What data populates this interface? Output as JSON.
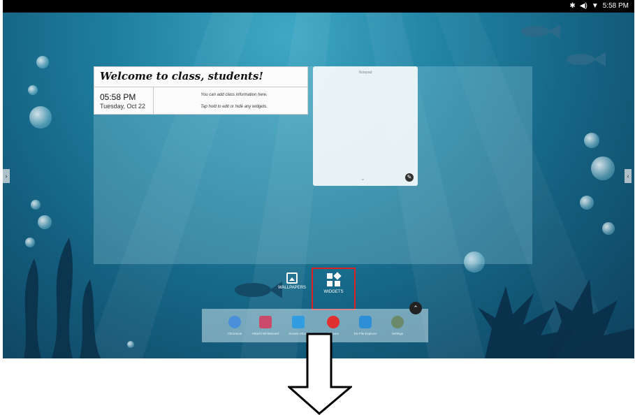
{
  "status_bar": {
    "icons": [
      "bluetooth-icon",
      "volume-icon",
      "wifi-icon"
    ],
    "time": "5:58 PM"
  },
  "welcome_widget": {
    "title": "Welcome to class, students!",
    "time": "05:58 PM",
    "date": "Tuesday, Oct 22",
    "info_line1": "You can add class information here.",
    "info_line2": "Tap hold to edit or hide any widgets."
  },
  "notepad_widget": {
    "title": "Notepad"
  },
  "launcher_buttons": [
    {
      "label": "WALLPAPERS",
      "icon": "wallpaper-icon"
    },
    {
      "label": "WIDGETS",
      "icon": "widgets-icon"
    }
  ],
  "dock": {
    "apps": [
      {
        "label": "Chromium",
        "icon": "chromium-icon",
        "color": "#4a8fd9"
      },
      {
        "label": "Hitachi Whiteboard",
        "icon": "whiteboard-icon",
        "color": "#c94a6a"
      },
      {
        "label": "Screen Share",
        "icon": "cast-icon",
        "color": "#2f9de0"
      },
      {
        "label": "Camera",
        "icon": "record-icon",
        "color": "#e03030"
      },
      {
        "label": "ES File Explorer",
        "icon": "es-file-icon",
        "color": "#2d8fd8"
      },
      {
        "label": "Settings",
        "icon": "gear-icon",
        "color": "#6a8a6a"
      }
    ]
  },
  "colors": {
    "highlight": "#e02020",
    "status_bar": "#000000"
  }
}
